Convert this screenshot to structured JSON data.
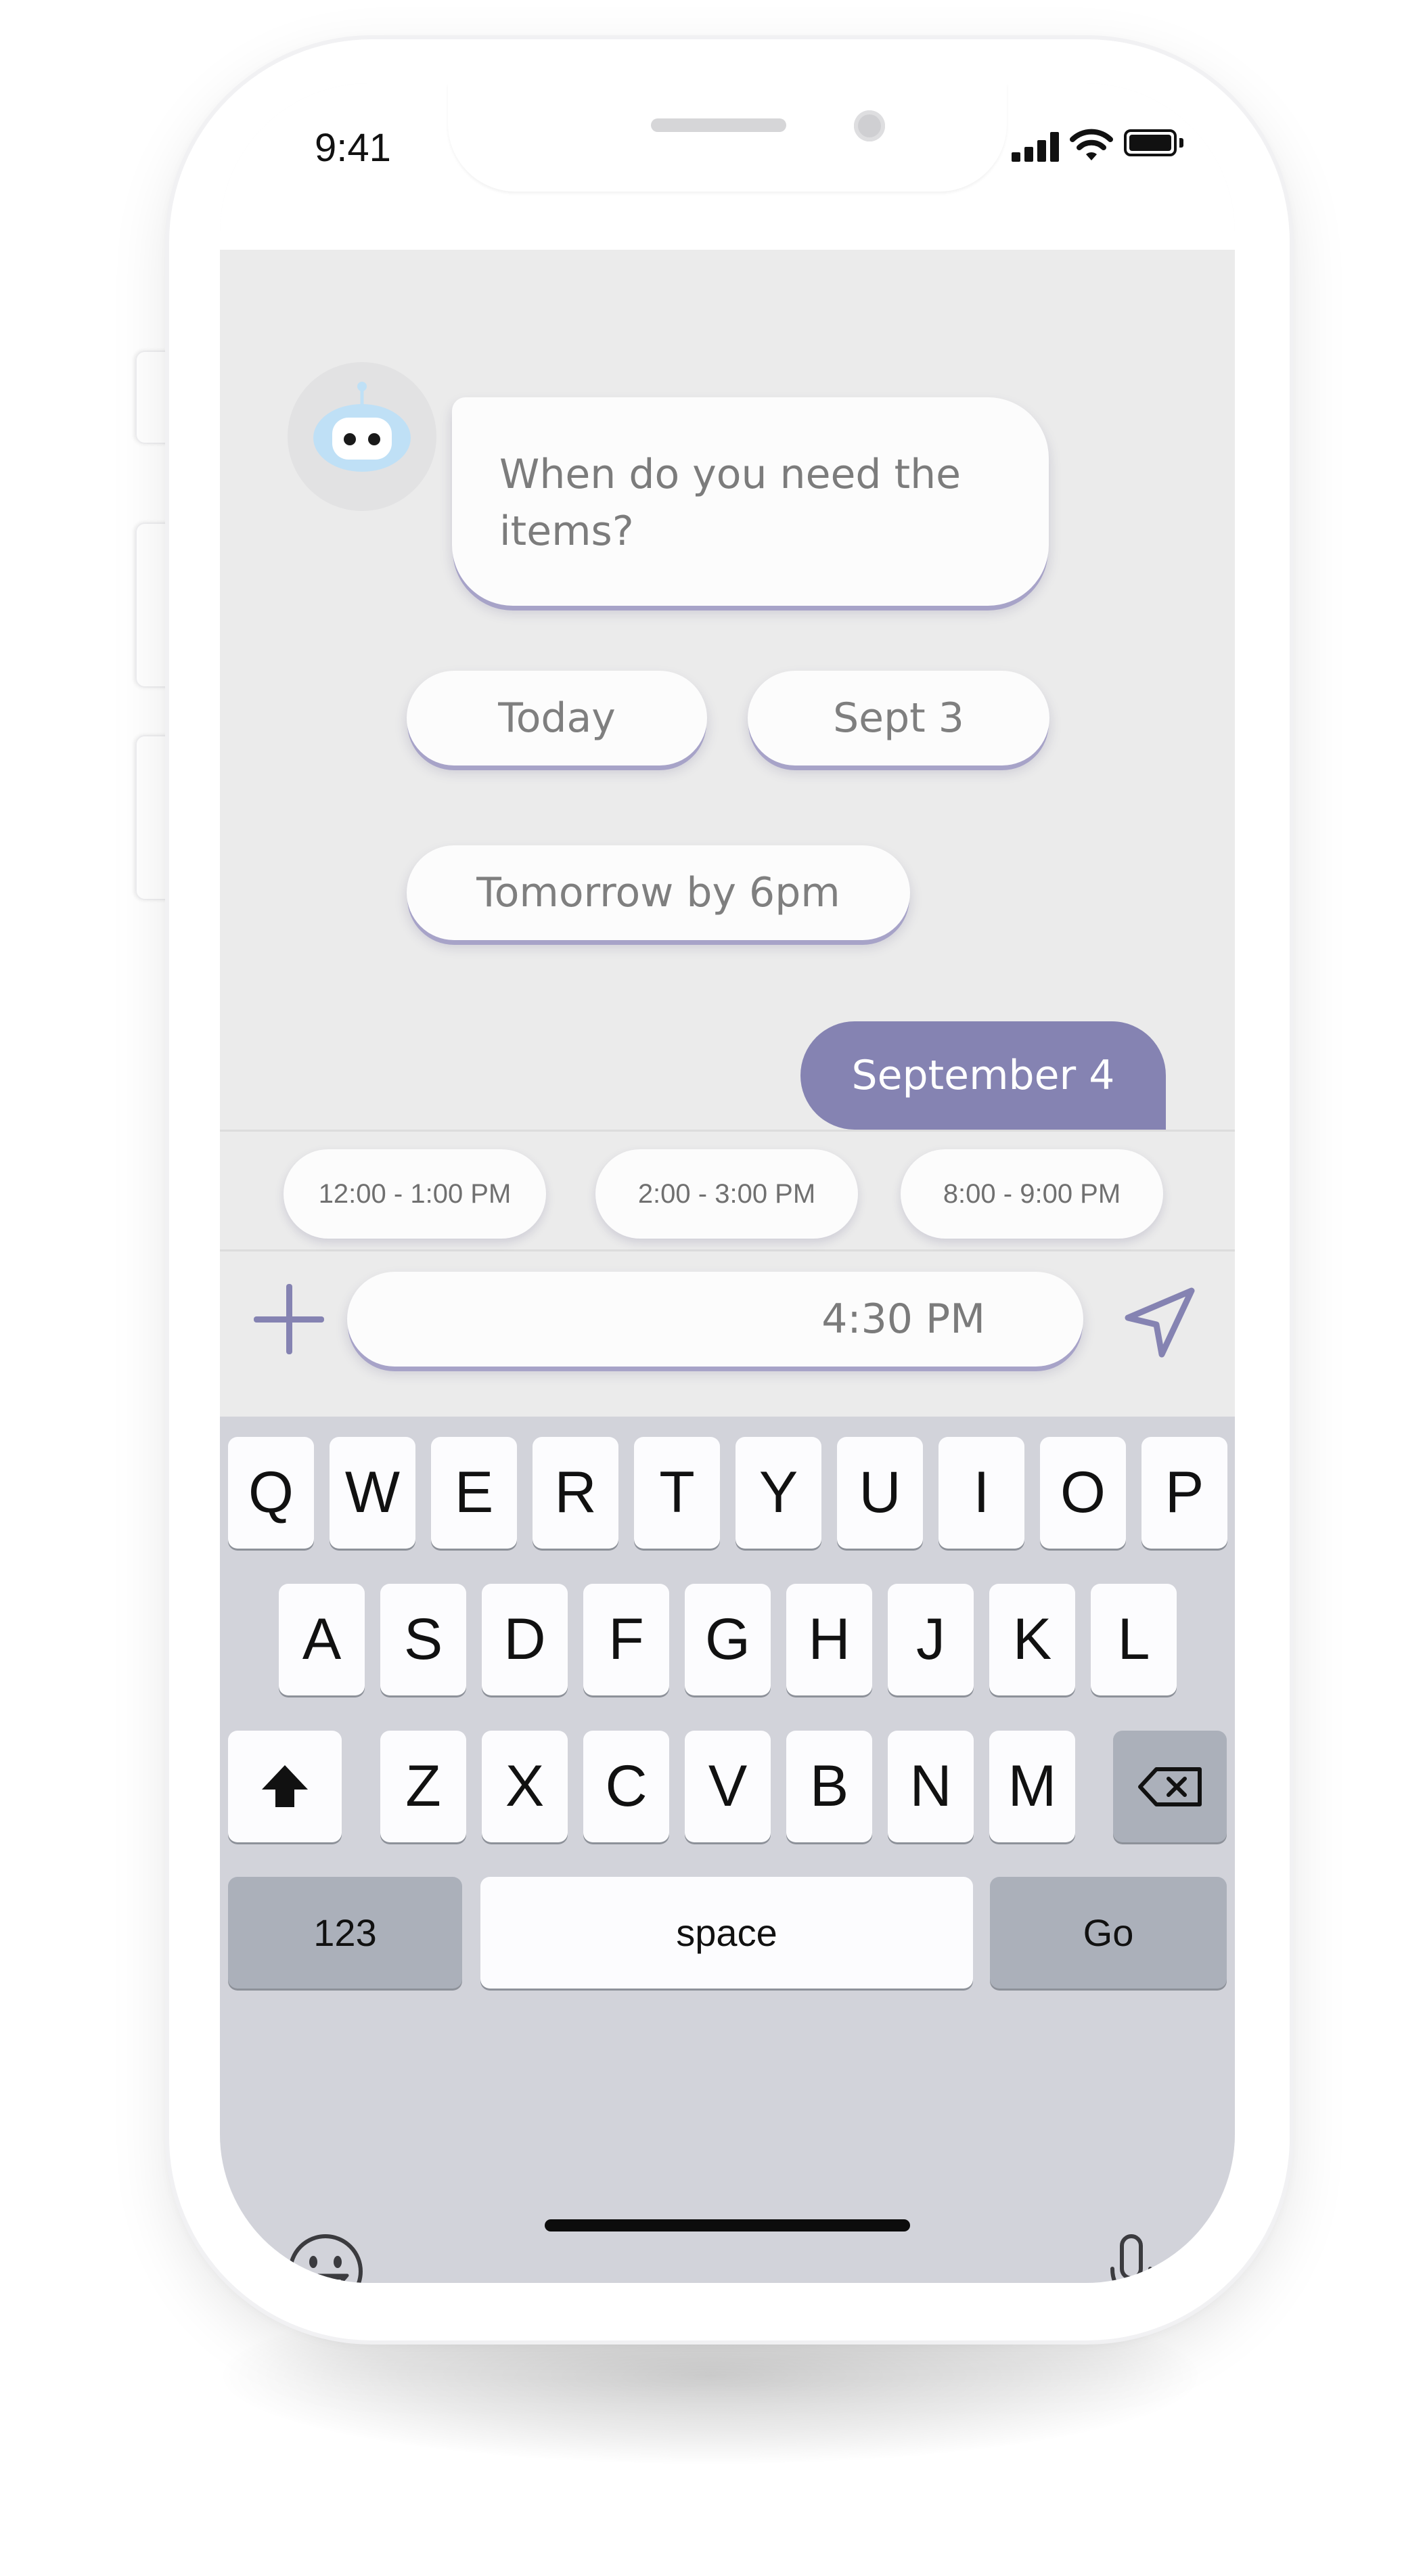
{
  "status_bar": {
    "time": "9:41"
  },
  "chat": {
    "bot_message": "When do you need the items?",
    "quick_replies": [
      "Today",
      "Sept 3",
      "Tomorrow by 6pm"
    ],
    "user_message": "September 4"
  },
  "time_slots": [
    "12:00 - 1:00 PM",
    "2:00 - 3:00 PM",
    "8:00 - 9:00 PM"
  ],
  "composer": {
    "value": "4:30 PM",
    "add_icon": "plus-icon",
    "send_icon": "send-arrow-icon"
  },
  "keyboard": {
    "row1": [
      "Q",
      "W",
      "E",
      "R",
      "T",
      "Y",
      "U",
      "I",
      "O",
      "P"
    ],
    "row2": [
      "A",
      "S",
      "D",
      "F",
      "G",
      "H",
      "J",
      "K",
      "L"
    ],
    "row3": [
      "Z",
      "X",
      "C",
      "V",
      "B",
      "N",
      "M"
    ],
    "numbers_key": "123",
    "space_key": "space",
    "go_key": "Go",
    "icons": [
      "shift-icon",
      "backspace-icon",
      "emoji-icon",
      "microphone-icon"
    ]
  },
  "colors": {
    "accent": "#8583b2",
    "chat_background": "#ebebeb",
    "bubble": "#fcfcfc",
    "keyboard_background": "#d2d3da",
    "bot_avatar": "#bfe0f6"
  }
}
